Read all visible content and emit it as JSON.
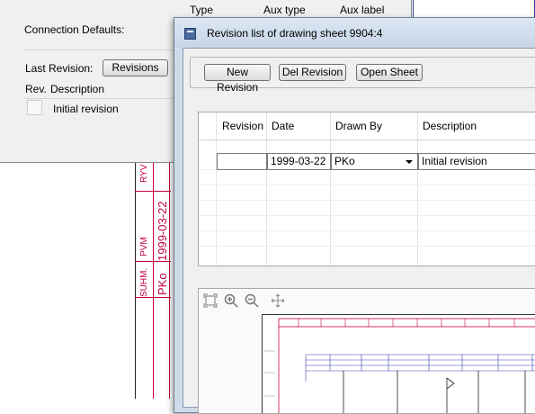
{
  "props": {
    "col_type": "Type",
    "col_aux_type": "Aux type",
    "col_aux_label": "Aux label",
    "connection_defaults": "Connection Defaults:",
    "last_revision": "Last Revision:",
    "revisions_button": "Revisions",
    "rev_header": "Rev.",
    "description_header": "Description",
    "row_description": "Initial revision"
  },
  "dialog": {
    "title": "Revision list of drawing sheet 9904:4",
    "toolbar": {
      "new_revision": "New Revision",
      "del_revision": "Del Revision",
      "open_sheet": "Open Sheet"
    },
    "grid": {
      "columns": [
        "Revision",
        "Date",
        "Drawn By",
        "Description"
      ],
      "row": {
        "revision": "",
        "date": "1999-03-22",
        "drawn_by": "PKo",
        "description": "Initial revision"
      }
    },
    "preview": {
      "tools": [
        "zoom-fit-icon",
        "zoom-in-icon",
        "zoom-out-icon",
        "pan-icon"
      ]
    }
  },
  "drawing": {
    "red_labels": [
      "RYV",
      "PVM",
      "SUHM.",
      "1999-03-22",
      "PKo"
    ]
  }
}
